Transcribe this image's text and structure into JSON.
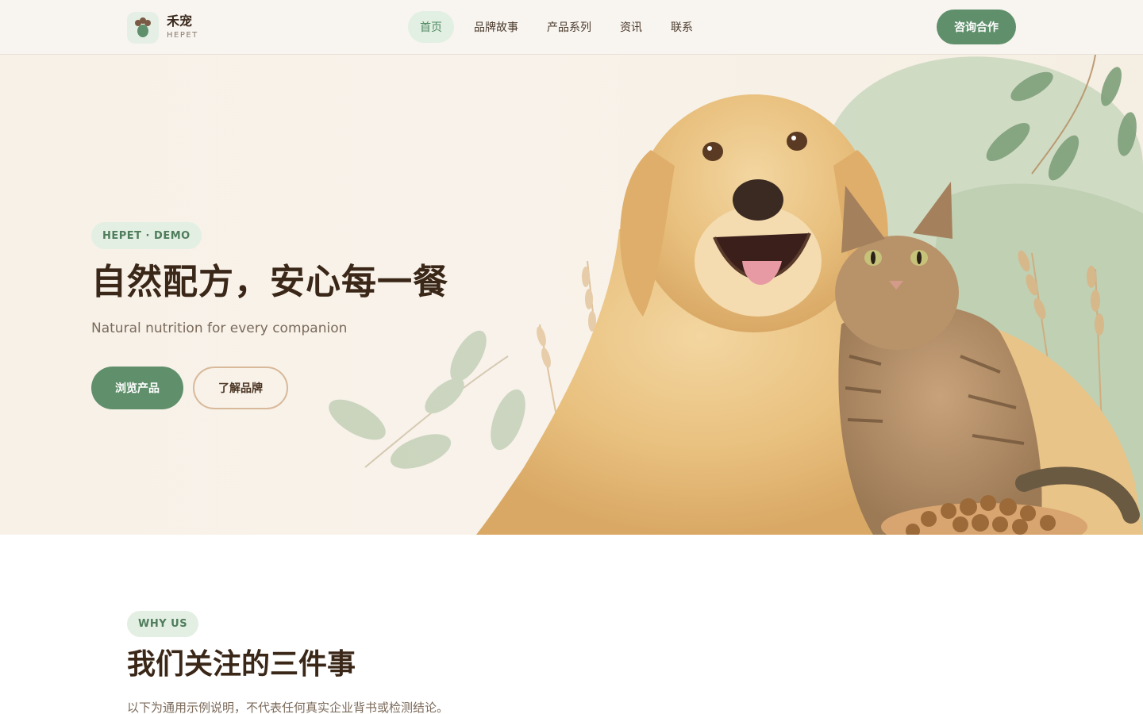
{
  "brand": {
    "name": "禾宠",
    "sub": "HEPET"
  },
  "nav": {
    "items": [
      {
        "label": "首页",
        "active": true
      },
      {
        "label": "品牌故事",
        "active": false
      },
      {
        "label": "产品系列",
        "active": false
      },
      {
        "label": "资讯",
        "active": false
      },
      {
        "label": "联系",
        "active": false
      }
    ],
    "cta_label": "咨询合作"
  },
  "hero": {
    "badge": "HEPET · DEMO",
    "title": "自然配方，安心每一餐",
    "subtitle": "Natural nutrition for every companion",
    "primary_label": "浏览产品",
    "secondary_label": "了解品牌",
    "image": {
      "subjects": [
        "golden-retriever",
        "tabby-cat",
        "kibble-bowl",
        "wheat",
        "leaves"
      ]
    }
  },
  "why": {
    "badge": "WHY US",
    "title": "我们关注的三件事",
    "description": "以下为通用示例说明，不代表任何真实企业背书或检测结论。"
  },
  "colors": {
    "accent": "#5f8f6b",
    "accent_soft": "#e3efe3",
    "text_dark": "#3a2718",
    "text_muted": "#7b6a5a",
    "outline": "#d8b99a",
    "header_bg": "#f8f5f0"
  }
}
